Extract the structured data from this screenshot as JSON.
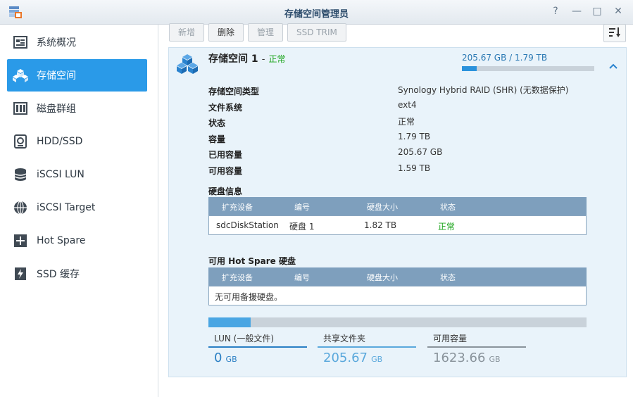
{
  "window": {
    "title": "存储空间管理员",
    "controls": [
      "?",
      "—",
      "□",
      "✕"
    ]
  },
  "sidebar": {
    "items": [
      {
        "label": "系统概况",
        "icon": "overview-icon"
      },
      {
        "label": "存储空间",
        "icon": "volume-cubes-icon",
        "active": true
      },
      {
        "label": "磁盘群组",
        "icon": "disk-group-icon"
      },
      {
        "label": "HDD/SSD",
        "icon": "hdd-icon"
      },
      {
        "label": "iSCSI LUN",
        "icon": "lun-icon"
      },
      {
        "label": "iSCSI Target",
        "icon": "globe-icon"
      },
      {
        "label": "Hot Spare",
        "icon": "hot-spare-icon"
      },
      {
        "label": "SSD 缓存",
        "icon": "ssd-cache-icon"
      }
    ]
  },
  "toolbar": {
    "create": "新增",
    "delete": "删除",
    "manage": "管理",
    "ssd_trim": "SSD TRIM"
  },
  "volume": {
    "name": "存储空间 1",
    "separator": "-",
    "status": "正常",
    "usage_text": "205.67 GB / 1.79 TB",
    "usage_fraction": 0.112,
    "details": [
      {
        "label": "存储空间类型",
        "value": "Synology Hybrid RAID (SHR) (无数据保护)"
      },
      {
        "label": "文件系统",
        "value": "ext4"
      },
      {
        "label": "状态",
        "value": "正常"
      },
      {
        "label": "容量",
        "value": "1.79 TB"
      },
      {
        "label": "已用容量",
        "value": "205.67 GB"
      },
      {
        "label": "可用容量",
        "value": "1.59 TB"
      }
    ],
    "disk_info": {
      "title": "硬盘信息",
      "columns": [
        "扩充设备",
        "编号",
        "硬盘大小",
        "状态"
      ],
      "rows": [
        {
          "device": "sdcDiskStation",
          "number": "硬盘 1",
          "size": "1.82 TB",
          "status": "正常"
        }
      ]
    },
    "hot_spare": {
      "title": "可用 Hot Spare 硬盘",
      "columns": [
        "扩充设备",
        "编号",
        "硬盘大小",
        "状态"
      ],
      "empty_text": "无可用备援硬盘。"
    },
    "summary": {
      "lun_fraction": 0,
      "shared_fraction": 0.112,
      "stats": [
        {
          "label": "LUN (一般文件)",
          "value": "0",
          "unit": "GB",
          "color": "#2a7fc4"
        },
        {
          "label": "共享文件夹",
          "value": "205.67",
          "unit": "GB",
          "color": "#5aa8dc"
        },
        {
          "label": "可用容量",
          "value": "1623.66",
          "unit": "GB",
          "color": "#8a949c"
        }
      ]
    }
  },
  "colors": {
    "accent": "#2a9ae8",
    "status_ok": "#1da51d",
    "table_header": "#7e9fbd",
    "panel_bg": "#e9f3fa"
  }
}
